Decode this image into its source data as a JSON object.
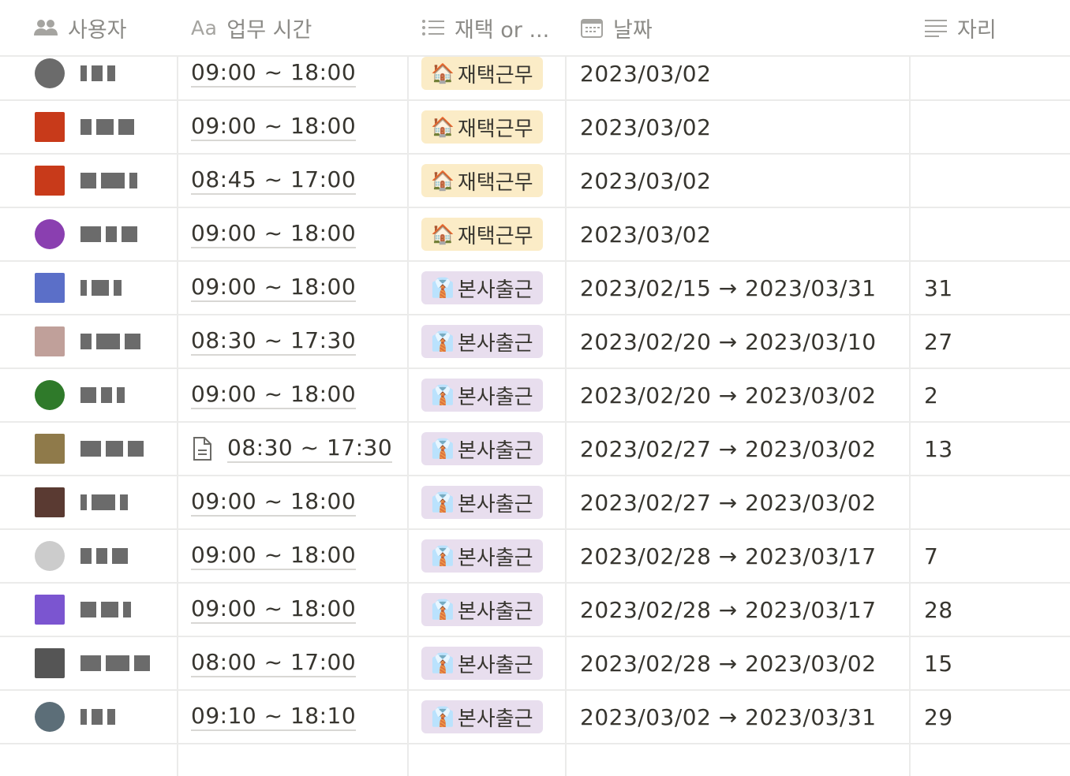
{
  "header": {
    "user": "사용자",
    "time_prefix": "Aa",
    "time": "업무 시간",
    "mode": "재택 or ...",
    "date": "날짜",
    "seat": "자리"
  },
  "rows": [
    {
      "time": "09:00 ~ 18:00",
      "tag": "재택근무",
      "tag_icon": "🏠",
      "date": "2023/03/02",
      "seat": ""
    },
    {
      "time": "09:00 ~ 18:00",
      "tag": "재택근무",
      "tag_icon": "🏠",
      "date": "2023/03/02",
      "seat": ""
    },
    {
      "time": "08:45 ~ 17:00",
      "tag": "재택근무",
      "tag_icon": "🏠",
      "date": "2023/03/02",
      "seat": ""
    },
    {
      "time": "09:00 ~ 18:00",
      "tag": "재택근무",
      "tag_icon": "🏠",
      "date": "2023/03/02",
      "seat": ""
    },
    {
      "time": "09:00 ~ 18:00",
      "tag": "본사출근",
      "tag_icon": "👔",
      "date": "2023/02/15 → 2023/03/31",
      "seat": "31"
    },
    {
      "time": "08:30 ~ 17:30",
      "tag": "본사출근",
      "tag_icon": "👔",
      "date": "2023/02/20 → 2023/03/10",
      "seat": "27"
    },
    {
      "time": "09:00 ~ 18:00",
      "tag": "본사출근",
      "tag_icon": "👔",
      "date": "2023/02/20 → 2023/03/02",
      "seat": "2"
    },
    {
      "time": "08:30 ~ 17:30",
      "tag": "본사출근",
      "tag_icon": "👔",
      "date": "2023/02/27 → 2023/03/02",
      "seat": "13",
      "doc": true
    },
    {
      "time": "09:00 ~ 18:00",
      "tag": "본사출근",
      "tag_icon": "👔",
      "date": "2023/02/27 → 2023/03/02",
      "seat": ""
    },
    {
      "time": "09:00 ~ 18:00",
      "tag": "본사출근",
      "tag_icon": "👔",
      "date": "2023/02/28 → 2023/03/17",
      "seat": "7"
    },
    {
      "time": "09:00 ~ 18:00",
      "tag": "본사출근",
      "tag_icon": "👔",
      "date": "2023/02/28 → 2023/03/17",
      "seat": "28"
    },
    {
      "time": "08:00 ~ 17:00",
      "tag": "본사출근",
      "tag_icon": "👔",
      "date": "2023/02/28 → 2023/03/02",
      "seat": "15"
    },
    {
      "time": "09:10 ~ 18:10",
      "tag": "본사출근",
      "tag_icon": "👔",
      "date": "2023/03/02 → 2023/03/31",
      "seat": "29"
    }
  ],
  "avatar_colors": [
    "#6b6b6b",
    "#c83a1a",
    "#c83a1a",
    "#8a3fb0",
    "#5b6fc8",
    "#c0a09a",
    "#2f7a2a",
    "#8f7a4a",
    "#5a3a32",
    "#cccccc",
    "#7b55d0",
    "#555555",
    "#5c6e78"
  ]
}
